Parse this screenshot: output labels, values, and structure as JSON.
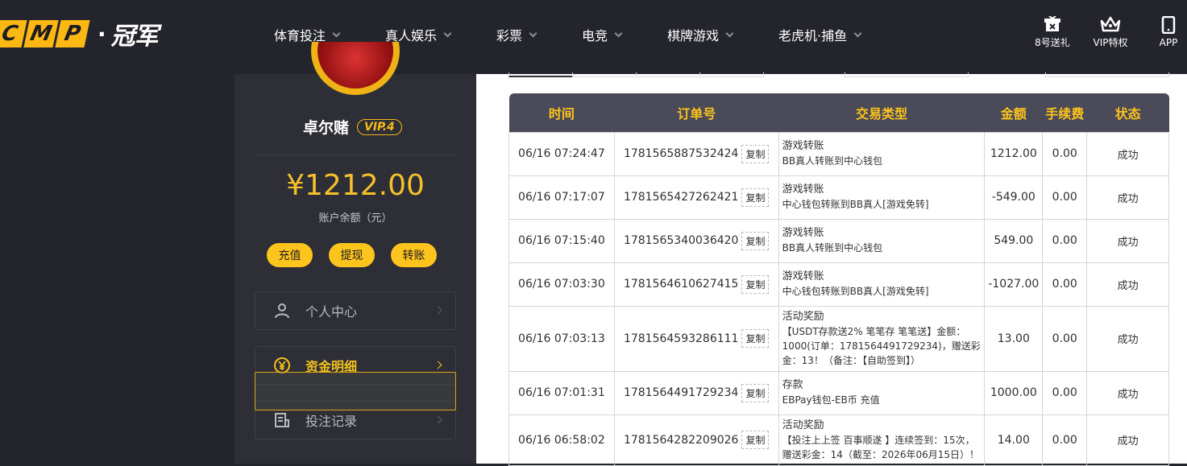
{
  "header": {
    "logo_letters": [
      "C",
      "M",
      "P"
    ],
    "logo_cn": "冠军",
    "nav": [
      {
        "label": "体育投注"
      },
      {
        "label": "真人娱乐"
      },
      {
        "label": "彩票"
      },
      {
        "label": "电竞"
      },
      {
        "label": "棋牌游戏"
      },
      {
        "label": "老虎机·捕鱼"
      }
    ],
    "right": [
      {
        "label": "8号送礼",
        "icon": "gift-icon"
      },
      {
        "label": "VIP特权",
        "icon": "crown-icon"
      },
      {
        "label": "APP",
        "icon": "phone-icon"
      }
    ]
  },
  "sidebar": {
    "username": "卓尔赌",
    "vip": "VIP.4",
    "balance": "¥1212.00",
    "balance_label": "账户余额（元）",
    "buttons": [
      {
        "label": "充值"
      },
      {
        "label": "提现"
      },
      {
        "label": "转账"
      }
    ],
    "menu": [
      {
        "label": "个人中心",
        "icon": "user-icon"
      },
      {
        "label": "资金明细",
        "icon": "yen-cycle-icon"
      },
      {
        "label": "投注记录",
        "icon": "document-icon"
      }
    ]
  },
  "table": {
    "headers": [
      "时间",
      "订单号",
      "交易类型",
      "金额",
      "手续费",
      "状态"
    ],
    "copy_label": "复制",
    "rows": [
      {
        "time": "06/16 07:24:47",
        "order": "1781565887532424",
        "type_title": "游戏转账",
        "type_desc": "BB真人转账到中心钱包",
        "amount": "1212.00",
        "fee": "0.00",
        "status": "成功"
      },
      {
        "time": "06/16 07:17:07",
        "order": "1781565427262421",
        "type_title": "游戏转账",
        "type_desc": "中心钱包转账到BB真人[游戏免转]",
        "amount": "-549.00",
        "fee": "0.00",
        "status": "成功"
      },
      {
        "time": "06/16 07:15:40",
        "order": "1781565340036420",
        "type_title": "游戏转账",
        "type_desc": "BB真人转账到中心钱包",
        "amount": "549.00",
        "fee": "0.00",
        "status": "成功"
      },
      {
        "time": "06/16 07:03:30",
        "order": "1781564610627415",
        "type_title": "游戏转账",
        "type_desc": "中心钱包转账到BB真人[游戏免转]",
        "amount": "-1027.00",
        "fee": "0.00",
        "status": "成功"
      },
      {
        "time": "06/16 07:03:13",
        "order": "1781564593286111",
        "type_title": "活动奖励",
        "type_desc": "【USDT存款送2% 笔笔存 笔笔送】金额：1000(订单：1781564491729234)，赠送彩金：13！（备注：【自助签到】）",
        "amount": "13.00",
        "fee": "0.00",
        "status": "成功"
      },
      {
        "time": "06/16 07:01:31",
        "order": "1781564491729234",
        "type_title": "存款",
        "type_desc": "EBPay钱包-EB币 充值",
        "amount": "1000.00",
        "fee": "0.00",
        "status": "成功"
      },
      {
        "time": "06/16 06:58:02",
        "order": "1781564282209026",
        "type_title": "活动奖励",
        "type_desc": "【投注上上签 百事顺遂 】连续签到：15次，赠送彩金：14（截至：2026年06月15日）！",
        "amount": "14.00",
        "fee": "0.00",
        "status": "成功"
      }
    ]
  },
  "colors": {
    "accent": "#fdc41d",
    "success": "#2ea74b",
    "header_bg": "#24252c",
    "sidebar_bg": "#2d2e36"
  }
}
